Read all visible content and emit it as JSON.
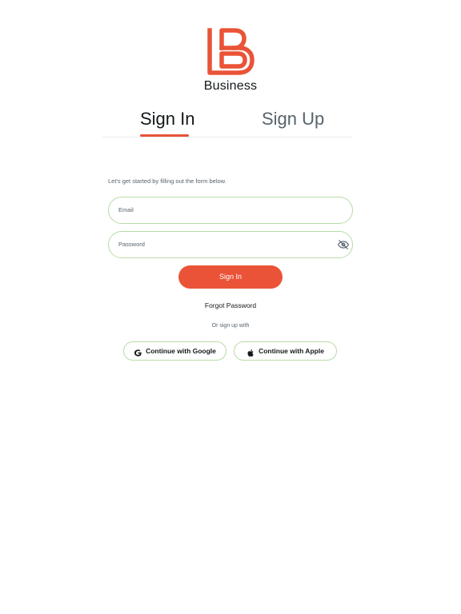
{
  "brand": {
    "name": "Business",
    "accent": "#ea5337"
  },
  "tabs": [
    {
      "label": "Sign In",
      "active": true
    },
    {
      "label": "Sign Up",
      "active": false
    }
  ],
  "form": {
    "subtitle": "Let's get started by filling out the form below.",
    "email": {
      "label": "Email",
      "value": ""
    },
    "password": {
      "label": "Password",
      "value": ""
    },
    "submit_label": "Sign In",
    "forgot_label": "Forgot Password"
  },
  "social": {
    "divider_text": "Or sign up with",
    "google_label": "Continue with Google",
    "apple_label": "Continue with Apple"
  },
  "colors": {
    "field_border": "#b7dca6",
    "primary_text": "#14181b",
    "secondary_text": "#57636c"
  }
}
